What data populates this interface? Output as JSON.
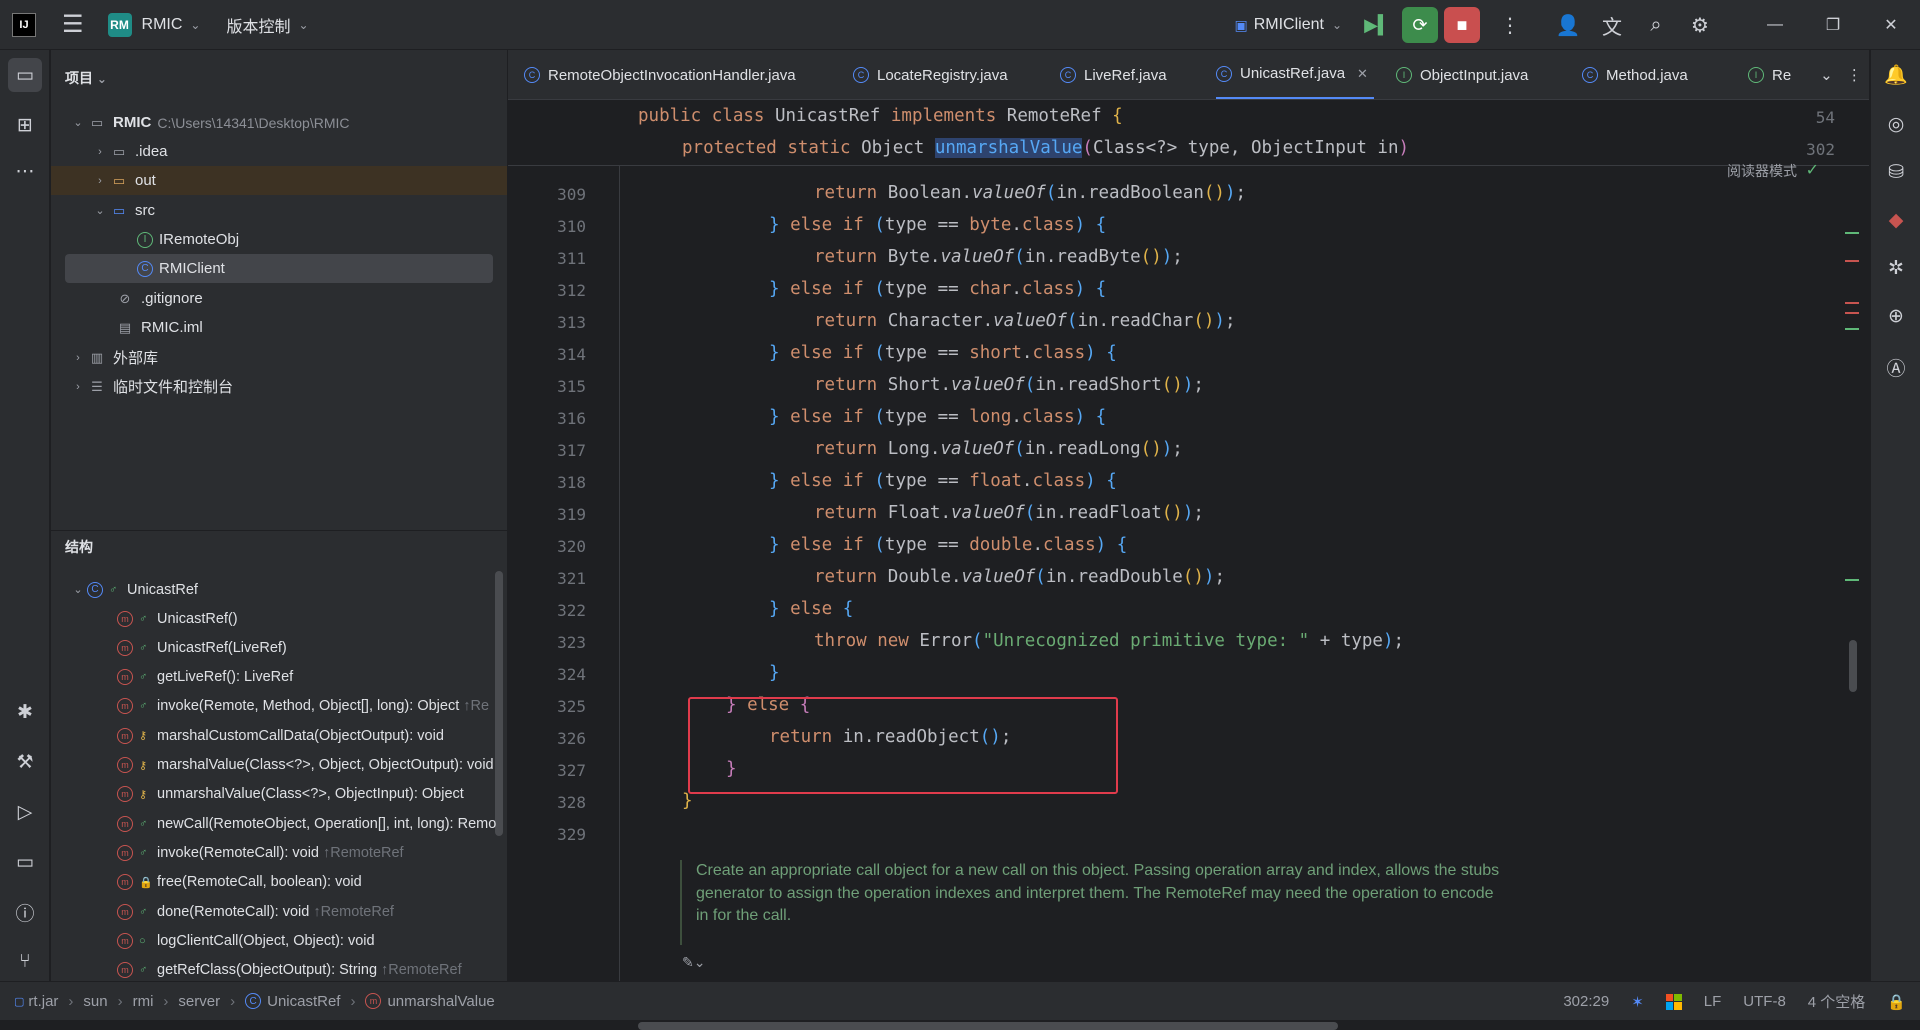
{
  "titlebar": {
    "logo": "IJ",
    "project_badge": "RM",
    "project_name": "RMIC",
    "vcs_label": "版本控制",
    "run_config": "RMIClient"
  },
  "project_panel": {
    "title": "项目",
    "root_name": "RMIC",
    "root_path": "C:\\Users\\14341\\Desktop\\RMIC",
    "items": [
      {
        "label": ".idea"
      },
      {
        "label": "out"
      },
      {
        "label": "src"
      },
      {
        "label": "IRemoteObj"
      },
      {
        "label": "RMIClient"
      },
      {
        "label": ".gitignore"
      },
      {
        "label": "RMIC.iml"
      },
      {
        "label": "外部库"
      },
      {
        "label": "临时文件和控制台"
      }
    ]
  },
  "structure_panel": {
    "title": "结构",
    "class_name": "UnicastRef",
    "members": [
      {
        "sig": "UnicastRef()",
        "inherited": ""
      },
      {
        "sig": "UnicastRef(LiveRef)",
        "inherited": ""
      },
      {
        "sig": "getLiveRef(): LiveRef",
        "inherited": ""
      },
      {
        "sig": "invoke(Remote, Method, Object[], long): Object",
        "inherited": "↑Re"
      },
      {
        "sig": "marshalCustomCallData(ObjectOutput): void",
        "inherited": ""
      },
      {
        "sig": "marshalValue(Class<?>, Object, ObjectOutput): void",
        "inherited": ""
      },
      {
        "sig": "unmarshalValue(Class<?>, ObjectInput): Object",
        "inherited": ""
      },
      {
        "sig": "newCall(RemoteObject, Operation[], int, long): Remo",
        "inherited": ""
      },
      {
        "sig": "invoke(RemoteCall): void",
        "inherited": "↑RemoteRef"
      },
      {
        "sig": "free(RemoteCall, boolean): void",
        "inherited": ""
      },
      {
        "sig": "done(RemoteCall): void",
        "inherited": "↑RemoteRef"
      },
      {
        "sig": "logClientCall(Object, Object): void",
        "inherited": ""
      },
      {
        "sig": "getRefClass(ObjectOutput): String",
        "inherited": "↑RemoteRef"
      }
    ]
  },
  "tabs": [
    {
      "label": "RemoteObjectInvocationHandler.java"
    },
    {
      "label": "LocateRegistry.java"
    },
    {
      "label": "LiveRef.java"
    },
    {
      "label": "UnicastRef.java"
    },
    {
      "label": "ObjectInput.java"
    },
    {
      "label": "Method.java"
    },
    {
      "label": "Re"
    }
  ],
  "editor": {
    "reader_mode": "阅读器模式",
    "sticky_lines": [
      {
        "num": "54"
      },
      {
        "num": "302"
      }
    ],
    "line_numbers": [
      "309",
      "310",
      "311",
      "312",
      "313",
      "314",
      "315",
      "316",
      "317",
      "318",
      "319",
      "320",
      "321",
      "322",
      "323",
      "324",
      "325",
      "326",
      "327",
      "328",
      "329"
    ],
    "doc_comment": "Create an appropriate call object for a new call on this object. Passing operation array and index, allows the stubs generator to assign the operation indexes and interpret them. The RemoteRef may need the operation to encode in for the call."
  },
  "statusbar": {
    "crumbs": [
      "rt.jar",
      "sun",
      "rmi",
      "server",
      "UnicastRef",
      "unmarshalValue"
    ],
    "position": "302:29",
    "line_sep": "LF",
    "encoding": "UTF-8",
    "indent": "4 个空格"
  }
}
